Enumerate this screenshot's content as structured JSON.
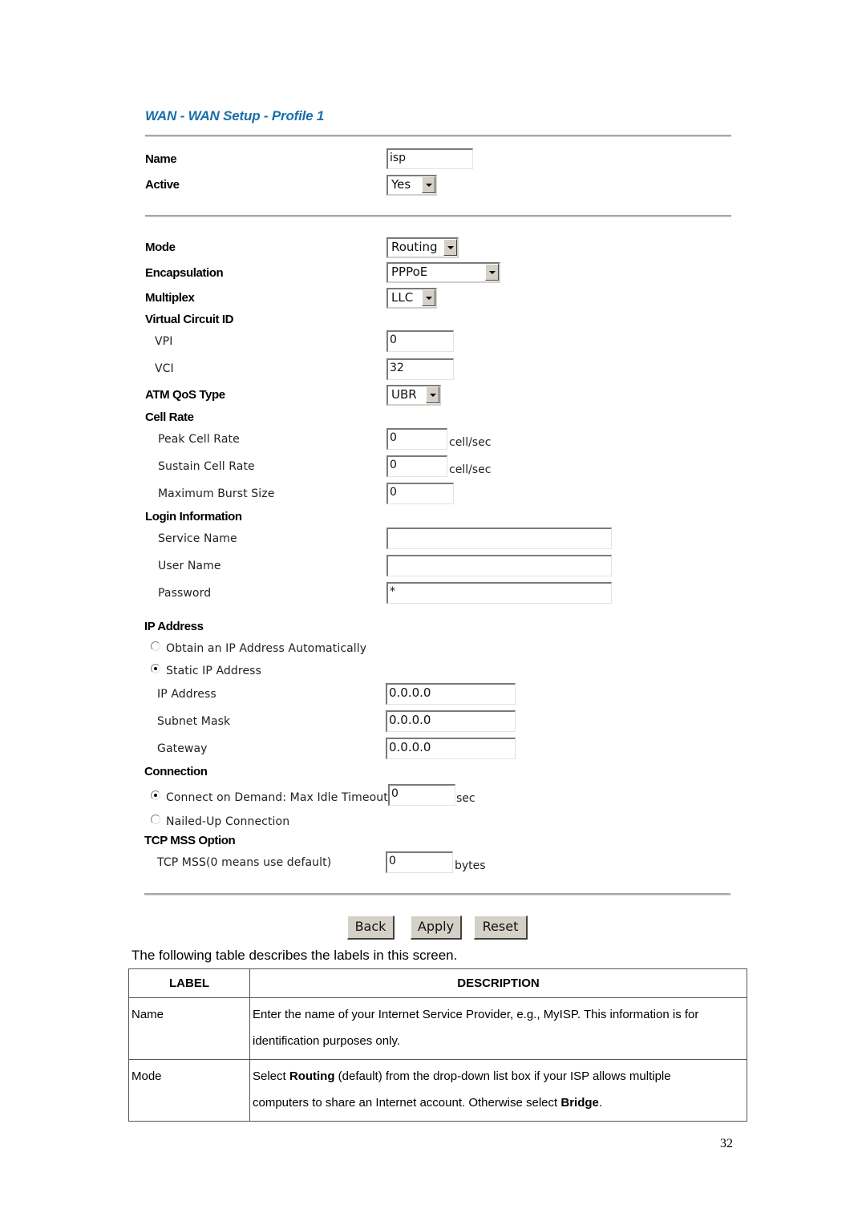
{
  "screen": {
    "title": "WAN - WAN Setup - Profile 1",
    "name": {
      "label": "Name",
      "value": "isp"
    },
    "active": {
      "label": "Active",
      "value": "Yes"
    },
    "mode": {
      "label": "Mode",
      "value": "Routing"
    },
    "encapsulation": {
      "label": "Encapsulation",
      "value": "PPPoE"
    },
    "multiplex": {
      "label": "Multiplex",
      "value": "LLC"
    },
    "virtual_circuit": {
      "heading": "Virtual Circuit ID",
      "vpi": {
        "label": "VPI",
        "value": "0"
      },
      "vci": {
        "label": "VCI",
        "value": "32"
      }
    },
    "atm_qos": {
      "label": "ATM QoS Type",
      "value": "UBR"
    },
    "cell_rate": {
      "heading": "Cell Rate",
      "peak": {
        "label": "Peak Cell Rate",
        "value": "0",
        "unit": "cell/sec"
      },
      "sustain": {
        "label": "Sustain Cell Rate",
        "value": "0",
        "unit": "cell/sec"
      },
      "burst": {
        "label": "Maximum Burst Size",
        "value": "0"
      }
    },
    "login": {
      "heading": "Login Information",
      "service_name": {
        "label": "Service Name",
        "value": ""
      },
      "user_name": {
        "label": "User Name",
        "value": ""
      },
      "password": {
        "label": "Password",
        "value": "*"
      }
    },
    "ip_address": {
      "heading": "IP Address",
      "auto": {
        "label": "Obtain an IP Address Automatically",
        "checked": false
      },
      "static": {
        "label": "Static IP Address",
        "checked": true
      },
      "ip": {
        "label": "IP Address",
        "value": "0.0.0.0"
      },
      "subnet": {
        "label": "Subnet Mask",
        "value": "0.0.0.0"
      },
      "gateway": {
        "label": "Gateway",
        "value": "0.0.0.0"
      }
    },
    "connection": {
      "heading": "Connection",
      "on_demand": {
        "label": "Connect on Demand: Max Idle Timeout",
        "value": "0",
        "unit": "sec",
        "checked": true
      },
      "nailed_up": {
        "label": "Nailed-Up Connection",
        "checked": false
      }
    },
    "tcp_mss": {
      "heading": "TCP MSS Option",
      "label": "TCP MSS(0 means use default)",
      "value": "0",
      "unit": "bytes"
    },
    "buttons": {
      "back": "Back",
      "apply": "Apply",
      "reset": "Reset"
    }
  },
  "intro_text": "The following table describes the labels in this screen.",
  "table": {
    "headers": [
      "LABEL",
      "DESCRIPTION"
    ],
    "rows": [
      {
        "label": "Name",
        "desc_line1": "Enter the name of your Internet Service Provider, e.g., MyISP. This information is for",
        "desc_line2": "identification purposes only."
      },
      {
        "label": "Mode",
        "desc_pre": "Select ",
        "desc_bold1": "Routing",
        "desc_mid": " (default) from the drop-down list box if your ISP allows multiple",
        "desc_line2_pre": "computers to share an Internet account. Otherwise select ",
        "desc_bold2": "Bridge",
        "desc_end": "."
      }
    ]
  },
  "page_number": "32"
}
